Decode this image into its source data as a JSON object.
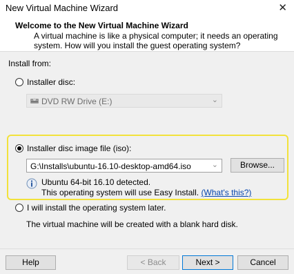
{
  "window": {
    "title": "New Virtual Machine Wizard",
    "close_glyph": "✕"
  },
  "header": {
    "title": "Welcome to the New Virtual Machine Wizard",
    "description": "A virtual machine is like a physical computer; it needs an operating system. How will you install the guest operating system?"
  },
  "install": {
    "label": "Install from:",
    "options": {
      "disc": {
        "label": "Installer disc:",
        "selected": false,
        "drive": "DVD RW Drive (E:)"
      },
      "iso": {
        "label": "Installer disc image file (iso):",
        "selected": true,
        "path": "G:\\Installs\\ubuntu-16.10-desktop-amd64.iso",
        "browse": "Browse...",
        "detected": "Ubuntu 64-bit 16.10 detected.",
        "easy_install": "This operating system will use Easy Install.",
        "whats_this": "(What's this?)"
      },
      "later": {
        "label": "I will install the operating system later.",
        "selected": false,
        "note": "The virtual machine will be created with a blank hard disk."
      }
    }
  },
  "footer": {
    "help": "Help",
    "back": "< Back",
    "next": "Next >",
    "cancel": "Cancel"
  },
  "icons": {
    "info": "info-icon",
    "drive": "disc-drive-icon",
    "dropdown": "chevron-down-icon"
  },
  "colors": {
    "highlight": "#f2e23a",
    "link": "#0645ad",
    "primary_border": "#0078d7"
  }
}
